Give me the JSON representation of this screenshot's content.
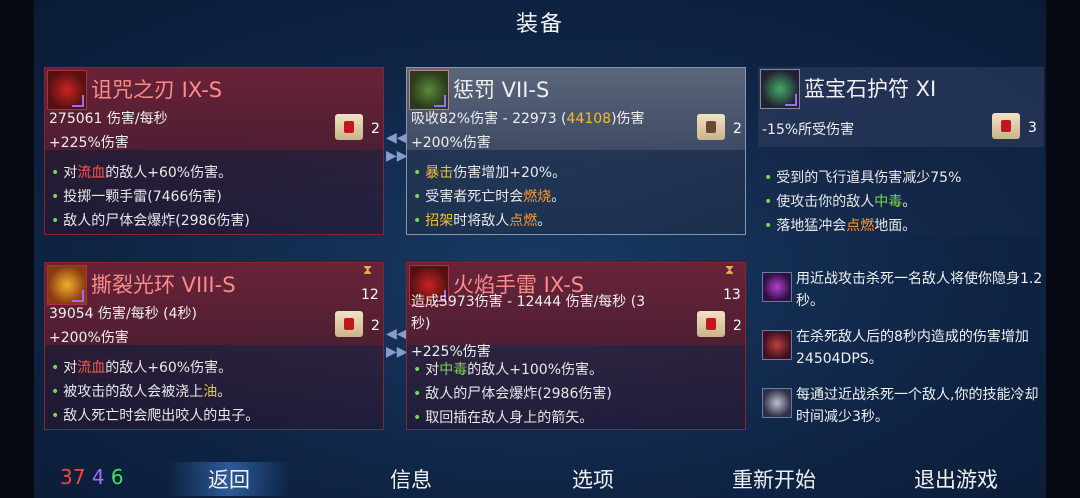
{
  "title": "装备",
  "colors": {
    "accent_red": "#ff8a8a",
    "green": "#7cd64a",
    "gold": "#f2c030",
    "orange": "#ff9a30"
  },
  "weapons": [
    {
      "name": "诅咒之刃 IX-S",
      "stat1": "275061 伤害/每秒",
      "stat2": "+225%伤害",
      "scroll_count": "2",
      "cut_line": "↑对流血的敌人+60%伤害。",
      "lines": [
        {
          "pre": "对",
          "hl": "流血",
          "post": "的敌人+60%伤害。"
        },
        {
          "pre": "投掷一颗手雷(7466伤害)",
          "hl": "",
          "post": ""
        },
        {
          "pre": "敌人的尸体会爆炸(2986伤害)",
          "hl": "",
          "post": ""
        }
      ]
    },
    {
      "name": "惩罚 VII-S",
      "stat1_pre": "吸收82%伤害 - 22973 (",
      "stat1_hl": "44108",
      "stat1_post": ")伤害",
      "stat2": "+200%伤害",
      "scroll_count": "2",
      "lines": [
        {
          "pre": "",
          "hl": "暴击",
          "post": "伤害增加+20%。"
        },
        {
          "pre": "受害者死亡时会",
          "hl": "燃烧",
          "post": "。"
        },
        {
          "pre": "",
          "hl": "招架",
          "post": "时将敌人",
          "hl2": "点燃",
          "post2": "。"
        }
      ]
    },
    {
      "name": "蓝宝石护符 XI",
      "stat1": "-15%所受伤害",
      "scroll_count": "3",
      "lines": [
        {
          "pre": "受到的飞行道具伤害减少75%",
          "hl": "",
          "post": ""
        },
        {
          "pre": "使攻击你的敌人",
          "hl": "中毒",
          "post": "。"
        },
        {
          "pre": "落地猛冲会",
          "hl": "点燃",
          "post": "地面。"
        }
      ]
    },
    {
      "name": "撕裂光环 VIII-S",
      "stat1": "39054 伤害/每秒 (4秒)",
      "stat2": "+200%伤害",
      "cooldown": "12",
      "scroll_count": "2",
      "lines": [
        {
          "pre": "对",
          "hl": "流血",
          "post": "的敌人+60%伤害。"
        },
        {
          "pre": "被攻击的敌人会被浇上",
          "hl": "油",
          "post": "。"
        },
        {
          "pre": "敌人死亡时会爬出咬人的虫子。",
          "hl": "",
          "post": ""
        }
      ]
    },
    {
      "name": "火焰手雷 IX-S",
      "stat1": "造成5973伤害 - 12444 伤害/每秒 (3",
      "stat1b": "秒)",
      "stat2": "+225%伤害",
      "cooldown": "13",
      "scroll_count": "2",
      "lines": [
        {
          "pre": "对",
          "hl": "中毒",
          "post": "的敌人+100%伤害。"
        },
        {
          "pre": "敌人的尸体会爆炸(2986伤害)",
          "hl": "",
          "post": ""
        },
        {
          "pre": "取回插在敌人身上的箭矢。",
          "hl": "",
          "post": ""
        }
      ]
    }
  ],
  "perks": [
    {
      "icon": "cloak-skull-icon",
      "text": "用近战攻击杀死一名敌人将使你隐身1.2秒。"
    },
    {
      "icon": "bow-icon",
      "text": "在杀死敌人后的8秒内造成的伤害增加24504DPS。"
    },
    {
      "icon": "blade-icon",
      "text": "每通过近战杀死一个敌人,你的技能冷却时间减少3秒。"
    }
  ],
  "stats": {
    "brutality": "37",
    "tactics": "4",
    "survival": "6"
  },
  "menu": {
    "back": "返回",
    "info": "信息",
    "options": "选项",
    "restart": "重新开始",
    "quit": "退出游戏"
  }
}
